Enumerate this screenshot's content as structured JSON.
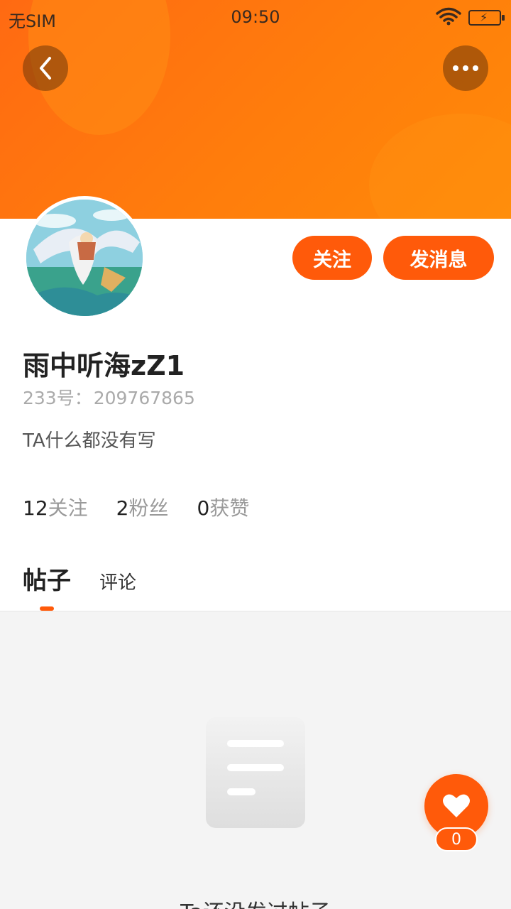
{
  "status_bar": {
    "carrier": "无SIM",
    "time": "09:50"
  },
  "header": {
    "back_icon": "chevron-left-icon",
    "more_icon": "more-dots-icon",
    "accent_color": "#ff5a0a"
  },
  "profile": {
    "nickname": "雨中听海zZ1",
    "id_label": "233号：",
    "id_value": "209767865",
    "bio": "TA什么都没有写",
    "follow_button": "关注",
    "message_button": "发消息",
    "stats": [
      {
        "count": "12",
        "label": "关注"
      },
      {
        "count": "2",
        "label": "粉丝"
      },
      {
        "count": "0",
        "label": "获赞"
      }
    ]
  },
  "tabs": [
    {
      "label": "帖子",
      "active": true
    },
    {
      "label": "评论",
      "active": false
    }
  ],
  "empty_state": {
    "text": "Ta还没发过帖子"
  },
  "like_fab": {
    "icon": "heart-icon",
    "count": "0"
  }
}
